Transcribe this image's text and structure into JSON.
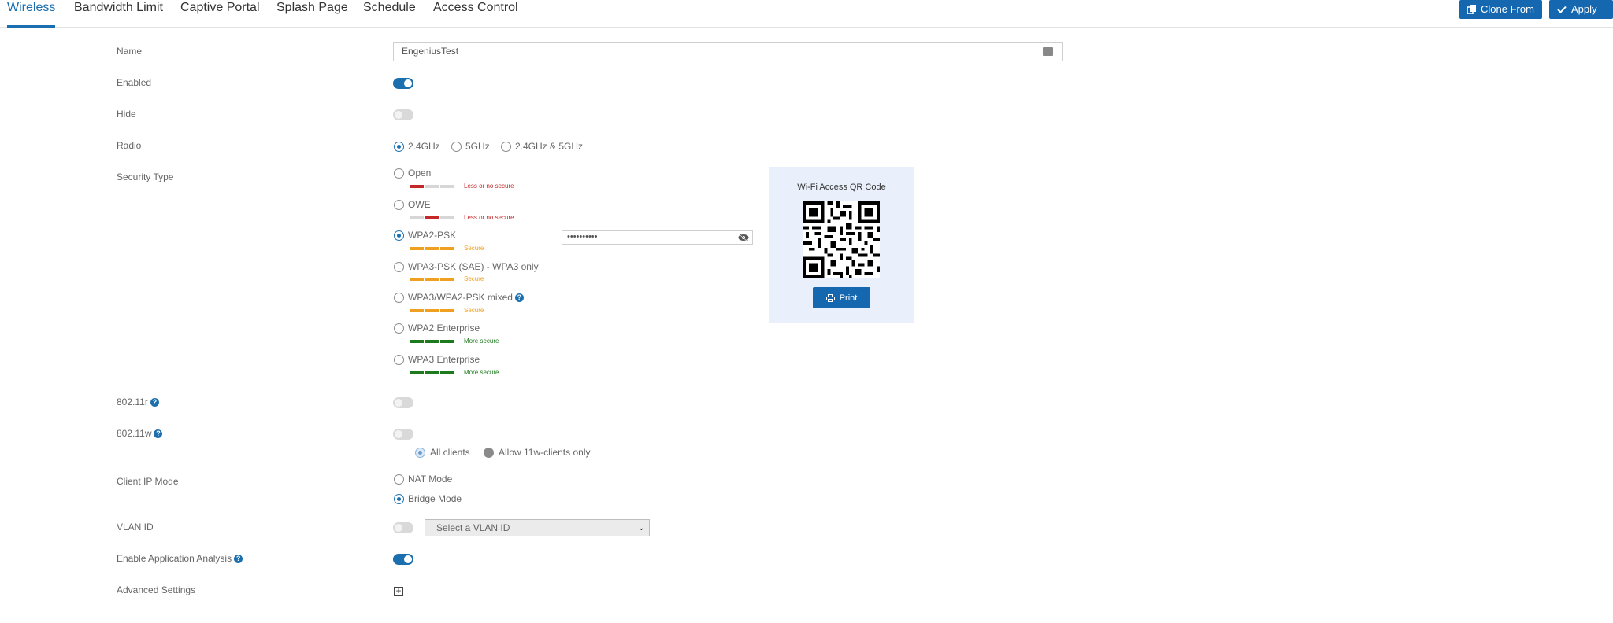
{
  "tabs": [
    "Wireless",
    "Bandwidth Limit",
    "Captive Portal",
    "Splash Page",
    "Schedule",
    "Access Control"
  ],
  "actions": {
    "clone_label": "Clone From",
    "apply_label": "Apply"
  },
  "form": {
    "name_label": "Name",
    "name_value": "EngeniusTest",
    "enabled_label": "Enabled",
    "hide_label": "Hide",
    "radio_label": "Radio",
    "radio_options": [
      "2.4GHz",
      "5GHz",
      "2.4GHz & 5GHz"
    ],
    "security_label": "Security Type",
    "security_options": [
      {
        "label": "Open",
        "note": "Less or no secure",
        "level": "low"
      },
      {
        "label": "OWE",
        "note": "Less or no secure",
        "level": "low"
      },
      {
        "label": "WPA2-PSK",
        "note": "Secure",
        "level": "medium"
      },
      {
        "label": "WPA3-PSK (SAE) - WPA3 only",
        "note": "Secure",
        "level": "medium"
      },
      {
        "label": "WPA3/WPA2-PSK mixed",
        "note": "Secure",
        "level": "medium"
      },
      {
        "label": "WPA2 Enterprise",
        "note": "More secure",
        "level": "high"
      },
      {
        "label": "WPA3 Enterprise",
        "note": "More secure",
        "level": "high"
      }
    ],
    "password_masked": "••••••••••",
    "qr_title": "Wi-Fi Access QR Code",
    "print_label": "Print",
    "r80211_label": "802.11r",
    "w80211_label": "802.11w",
    "w80211_options": [
      "All clients",
      "Allow 11w-clients only"
    ],
    "client_ip_label": "Client IP Mode",
    "client_ip_options": [
      "NAT Mode",
      "Bridge Mode"
    ],
    "vlan_label": "VLAN ID",
    "vlan_placeholder": "Select a VLAN ID",
    "app_analysis_label": "Enable Application Analysis",
    "advanced_label": "Advanced Settings"
  },
  "colors": {
    "accent": "#1b6fae",
    "low": "#c62828",
    "medium": "#f0a020",
    "high": "#1e7a1e",
    "qr_panel_bg": "#eaf0fb"
  }
}
